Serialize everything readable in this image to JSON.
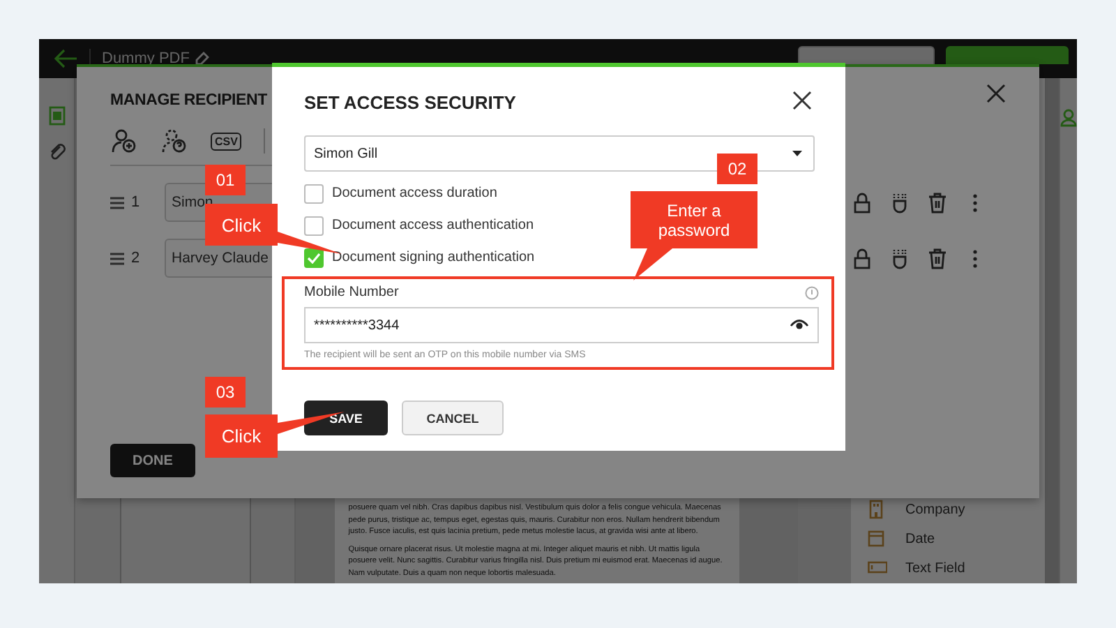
{
  "app_bar": {
    "document_title": "Dummy PDF",
    "buttons": [
      {
        "kind": "secondary"
      },
      {
        "kind": "primary"
      }
    ]
  },
  "document": {
    "paragraphs": [
      "posuere quam vel nibh. Cras dapibus dapibus nisl. Vestibulum quis dolor a felis congue vehicula. Maecenas pede purus, tristique ac, tempus eget, egestas quis, mauris. Curabitur non eros. Nullam hendrerit bibendum justo. Fusce iaculis, est quis lacinia pretium, pede metus molestie lacus, at gravida wisi ante at libero.",
      "Quisque ornare placerat risus. Ut molestie magna at mi. Integer aliquet mauris et nibh. Ut mattis ligula posuere velit. Nunc sagittis. Curabitur varius fringilla nisl. Duis pretium mi euismod erat. Maecenas id augue. Nam vulputate. Duis a quam non neque lobortis malesuada."
    ]
  },
  "fields_panel": {
    "items": [
      {
        "label": "Company",
        "kind": "company"
      },
      {
        "label": "Date",
        "kind": "date"
      },
      {
        "label": "Text Field",
        "kind": "text"
      }
    ]
  },
  "manage_recipients": {
    "title": "MANAGE RECIPIENT",
    "csv_label": "CSV",
    "recipients": [
      {
        "number": "1",
        "name": "Simon"
      },
      {
        "number": "2",
        "name": "Harvey Claude"
      }
    ],
    "done": "DONE"
  },
  "access_security": {
    "title": "SET ACCESS SECURITY",
    "recipient": "Simon Gill",
    "options": [
      {
        "label": "Document access duration",
        "checked": false
      },
      {
        "label": "Document access authentication",
        "checked": false
      },
      {
        "label": "Document signing authentication",
        "checked": true
      }
    ],
    "mobile": {
      "label": "Mobile Number",
      "value": "**********3344",
      "hint": "The recipient will be sent an OTP on this mobile number via SMS"
    },
    "buttons": [
      {
        "label": "SAVE",
        "kind": "primary"
      },
      {
        "label": "CANCEL",
        "kind": "secondary"
      }
    ]
  },
  "annotations": [
    {
      "number": "01",
      "text": "Click",
      "kind": "left"
    },
    {
      "number": "02",
      "text": "Enter a password",
      "kind": "down"
    },
    {
      "number": "03",
      "text": "Click",
      "kind": "left"
    }
  ]
}
